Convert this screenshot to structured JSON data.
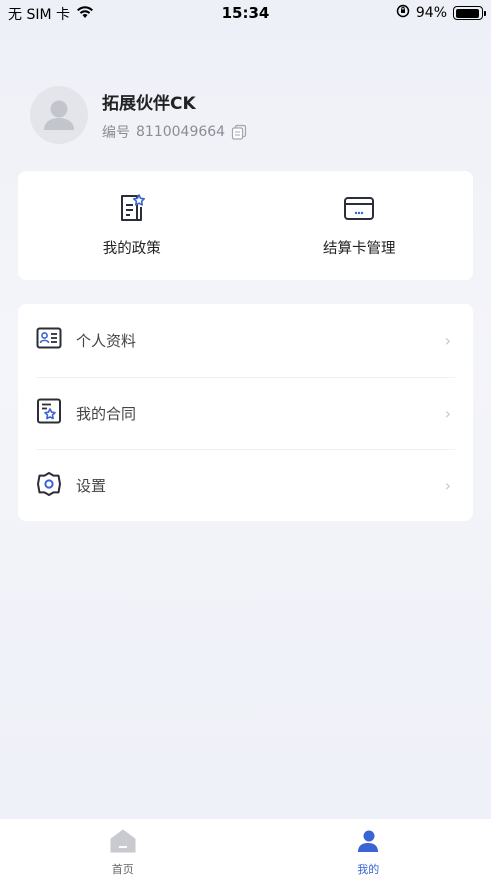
{
  "status_bar": {
    "carrier": "无 SIM 卡",
    "time": "15:34",
    "battery_percent": "94%",
    "battery_level": 0.94
  },
  "profile": {
    "name": "拓展伙伴CK",
    "id_label": "编号",
    "id_value": "8110049664"
  },
  "quick_actions": [
    {
      "label": "我的政策",
      "icon": "policy-document-icon"
    },
    {
      "label": "结算卡管理",
      "icon": "bank-card-icon"
    }
  ],
  "menu": [
    {
      "label": "个人资料",
      "icon": "id-card-icon"
    },
    {
      "label": "我的合同",
      "icon": "contract-icon"
    },
    {
      "label": "设置",
      "icon": "gear-icon"
    }
  ],
  "tabbar": {
    "tabs": [
      {
        "label": "首页",
        "icon": "home-icon",
        "active": false
      },
      {
        "label": "我的",
        "icon": "user-icon",
        "active": true
      }
    ]
  },
  "colors": {
    "accent": "#3a63d6",
    "icon_dark": "#2b2e38",
    "chevron": "#c4c6cc",
    "background": "#eef0f7"
  }
}
